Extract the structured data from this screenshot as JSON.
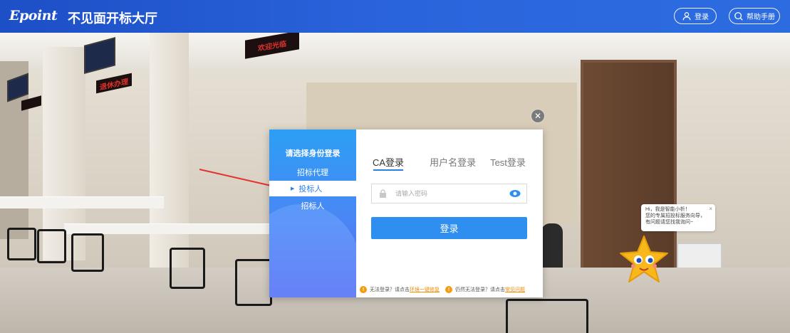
{
  "header": {
    "logo_text": "Epoint",
    "title": "不见面开标大厅",
    "login_button": "登录",
    "help_button": "帮助手册",
    "user_icon": "user-icon",
    "search_icon": "search-icon"
  },
  "scene": {
    "led_sign_main": "欢迎光临",
    "led_sign_small": "退休办理"
  },
  "dialog": {
    "role_panel_title": "请选择身份登录",
    "roles": [
      "招标代理",
      "投标人",
      "招标人"
    ],
    "selected_role": "投标人",
    "tabs": [
      "CA登录",
      "用户名登录",
      "Test登录"
    ],
    "active_tab": "CA登录",
    "password_placeholder": "请输入密码",
    "login_button": "登录",
    "footer_text_1": "无法登录？请点击",
    "footer_link_1": "环境一键修复",
    "footer_text_2": "仍然无法登录？请点击",
    "footer_link_2": "常见问题"
  },
  "assistant": {
    "greeting_line1": "Hi，我是智能小析！",
    "greeting_line2": "您的专属招投标服务向导，",
    "greeting_line3": "有问题请您找我询问~",
    "close_symbol": "×"
  },
  "colors": {
    "topbar": "#2a64dc",
    "primary": "#2f8ff0",
    "link": "#f08a00",
    "warning": "#f39c12"
  }
}
